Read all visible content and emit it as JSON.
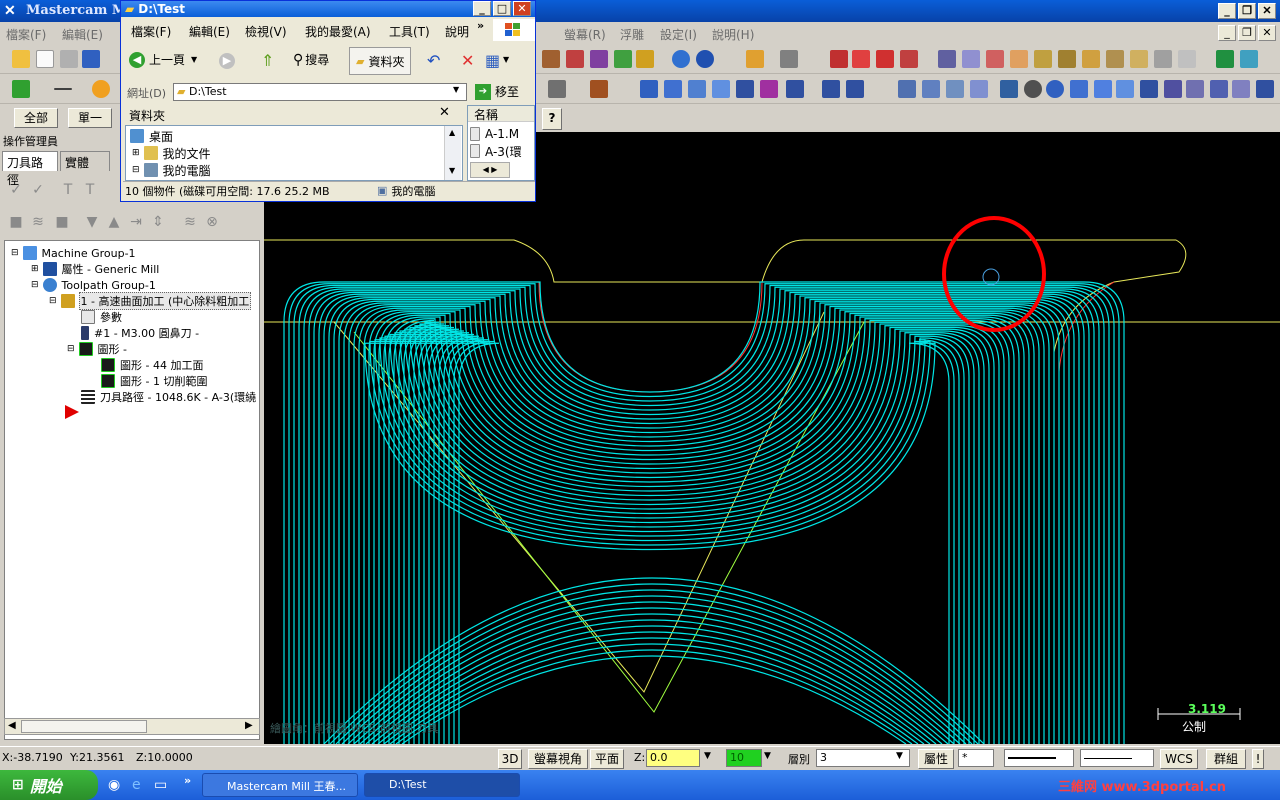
{
  "mastercam": {
    "title": "Mastercam Mill",
    "menus": [
      "檔案(F)",
      "編輯(E)",
      "螢幕(R)",
      "浮雕",
      "設定(I)",
      "說明(H)"
    ],
    "btn_all": "全部",
    "btn_single": "單一"
  },
  "ops_manager": {
    "title": "操作管理員",
    "tabs": [
      "刀具路徑",
      "實體"
    ],
    "tree": [
      {
        "label": "Machine Group-1"
      },
      {
        "label": "屬性 - Generic Mill"
      },
      {
        "label": "Toolpath Group-1"
      },
      {
        "label": "1 - 高速曲面加工 (中心除料粗加工"
      },
      {
        "label": "參數"
      },
      {
        "label": "#1 - M3.00 圓鼻刀 -"
      },
      {
        "label": "圖形 -"
      },
      {
        "label": "圖形 - 44 加工面"
      },
      {
        "label": "圖形 - 1 切削範圍"
      },
      {
        "label": "刀具路徑 - 1048.6K - A-3(環繞"
      }
    ]
  },
  "explorer": {
    "title": "D:\\Test",
    "menus": [
      "檔案(F)",
      "編輯(E)",
      "檢視(V)",
      "我的最愛(A)",
      "工具(T)",
      "說明"
    ],
    "back": "上一頁",
    "search": "搜尋",
    "folders": "資料夾",
    "address_label": "網址(D)",
    "address_value": "D:\\Test",
    "go": "移至",
    "folders_pane_title": "資料夾",
    "name_header": "名稱",
    "tree": [
      "桌面",
      "我的文件",
      "我的電腦"
    ],
    "files": [
      "A-1.M",
      "A-3(環"
    ],
    "status": "10 個物件 (磁碟可用空間: 17.6  25.2 MB",
    "status_location": "我的電腦"
  },
  "viewport": {
    "overlay_text": "繪圖角：前視圖   WCS:前視圖   刀具",
    "scale_value": "3.119",
    "scale_unit": "公制",
    "colors": {
      "toolpath": "#00e5e5",
      "boundary": "#e8e85a",
      "annotation": "#ff0000"
    }
  },
  "statusbar": {
    "x": "X:-38.7190",
    "y": "Y:21.3561",
    "z": "Z:10.0000",
    "btn_3d": "3D",
    "btn_gview": "螢幕視角",
    "btn_plane": "平面",
    "z_label": "Z:",
    "z_value": "0.0",
    "color_value": "10",
    "level_label": "層別",
    "level_value": "3",
    "attr": "屬性",
    "wcs": "WCS",
    "group": "群組"
  },
  "taskbar": {
    "start": "開始",
    "tasks": [
      "Mastercam Mill 王春...",
      "D:\\Test"
    ],
    "watermark": "三維网 www.3dportal.cn"
  }
}
